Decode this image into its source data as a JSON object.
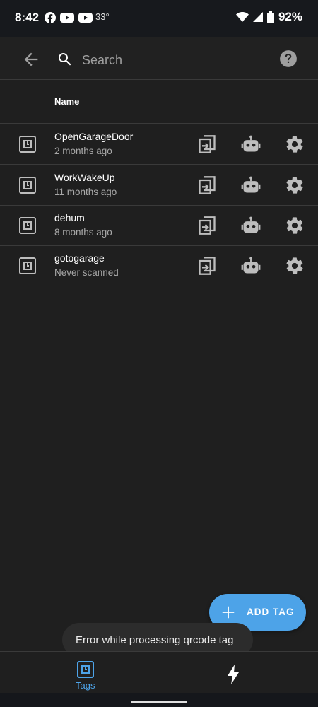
{
  "status_bar": {
    "time": "8:42",
    "temperature": "33°",
    "battery": "92%",
    "notification_icons": [
      "facebook-icon",
      "youtube-icon",
      "youtube-icon"
    ]
  },
  "app_bar": {
    "search_placeholder": "Search"
  },
  "table": {
    "column_name": "Name",
    "rows": [
      {
        "name": "OpenGarageDoor",
        "last_scanned": "2 months ago"
      },
      {
        "name": "WorkWakeUp",
        "last_scanned": "11 months ago"
      },
      {
        "name": "dehum",
        "last_scanned": "8 months ago"
      },
      {
        "name": "gotogarage",
        "last_scanned": "Never scanned"
      }
    ]
  },
  "fab": {
    "label": "ADD TAG"
  },
  "toast": {
    "message": "Error while processing qrcode tag"
  },
  "bottom_nav": {
    "items": [
      {
        "label": "Tags",
        "icon": "nfc-tag-icon",
        "active": true
      },
      {
        "label": "",
        "icon": "lightning-icon",
        "active": false
      }
    ]
  },
  "colors": {
    "background": "#1f1f1f",
    "accent": "#4da3e8",
    "divider": "#3a3a3a",
    "icon_gray": "#bdbdbd"
  }
}
